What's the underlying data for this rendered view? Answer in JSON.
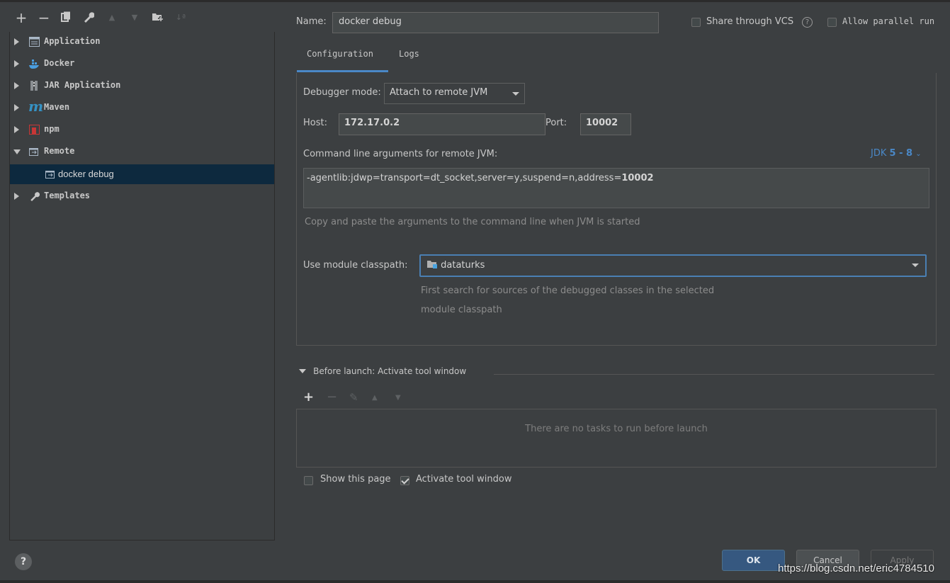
{
  "toolbar": {
    "add": "+",
    "remove": "−",
    "copy": "⧉",
    "settings": "🔧",
    "up": "▲",
    "down": "▼",
    "folder": "📁",
    "sort": "↓ª"
  },
  "tree": [
    {
      "label": "Application",
      "expanded": false,
      "icon": "application-icon"
    },
    {
      "label": "Docker",
      "expanded": false,
      "icon": "docker-icon"
    },
    {
      "label": "JAR Application",
      "expanded": false,
      "icon": "jar-icon"
    },
    {
      "label": "Maven",
      "expanded": false,
      "icon": "maven-icon",
      "glyph": "m"
    },
    {
      "label": "npm",
      "expanded": false,
      "icon": "npm-icon"
    },
    {
      "label": "Remote",
      "expanded": true,
      "icon": "remote-icon"
    },
    {
      "label": "docker debug",
      "child": true,
      "selected": true,
      "icon": "remote-config-icon"
    },
    {
      "label": "Templates",
      "expanded": false,
      "icon": "wrench-icon"
    }
  ],
  "header": {
    "name_label": "Name:",
    "name_value": "docker debug",
    "share_vcs": "Share through VCS",
    "share_vcs_checked": false,
    "help_glyph": "?",
    "allow_parallel": "Allow parallel run",
    "allow_parallel_checked": false
  },
  "tabs": [
    {
      "label": "Configuration",
      "active": true
    },
    {
      "label": "Logs",
      "active": false
    }
  ],
  "config": {
    "debugger_mode_label": "Debugger mode:",
    "debugger_mode_value": "Attach to remote JVM",
    "host_label": "Host:",
    "host_value": "172.17.0.2",
    "port_label": "Port:",
    "port_value": "10002",
    "cmd_label": "Command line arguments for remote JVM:",
    "jdk_label": "JDK",
    "jdk_range": "5 - 8",
    "cmd_prefix": "-agentlib:jdwp=transport=dt_socket,server=y,suspend=n,address=",
    "cmd_port": "10002",
    "copy_hint": "Copy and paste the arguments to the command line when JVM is started",
    "module_label": "Use module classpath:",
    "module_value": "dataturks",
    "module_hint_1": "First search for sources of the debugged classes in the selected",
    "module_hint_2": "module classpath"
  },
  "before_launch": {
    "title": "Before launch: Activate tool window",
    "add": "+",
    "remove": "−",
    "edit": "✎",
    "up": "▲",
    "down": "▼",
    "empty_text": "There are no tasks to run before launch",
    "show_page": "Show this page",
    "show_page_checked": false,
    "activate_tool": "Activate tool window",
    "activate_tool_checked": true
  },
  "footer": {
    "help": "?",
    "ok": "OK",
    "cancel": "Cancel",
    "apply": "Apply",
    "watermark": "https://blog.csdn.net/eric4784510"
  },
  "colors": {
    "background": "#3c3f41",
    "selection": "#0d293e",
    "accent": "#4a88c7",
    "ok_button": "#365880"
  }
}
